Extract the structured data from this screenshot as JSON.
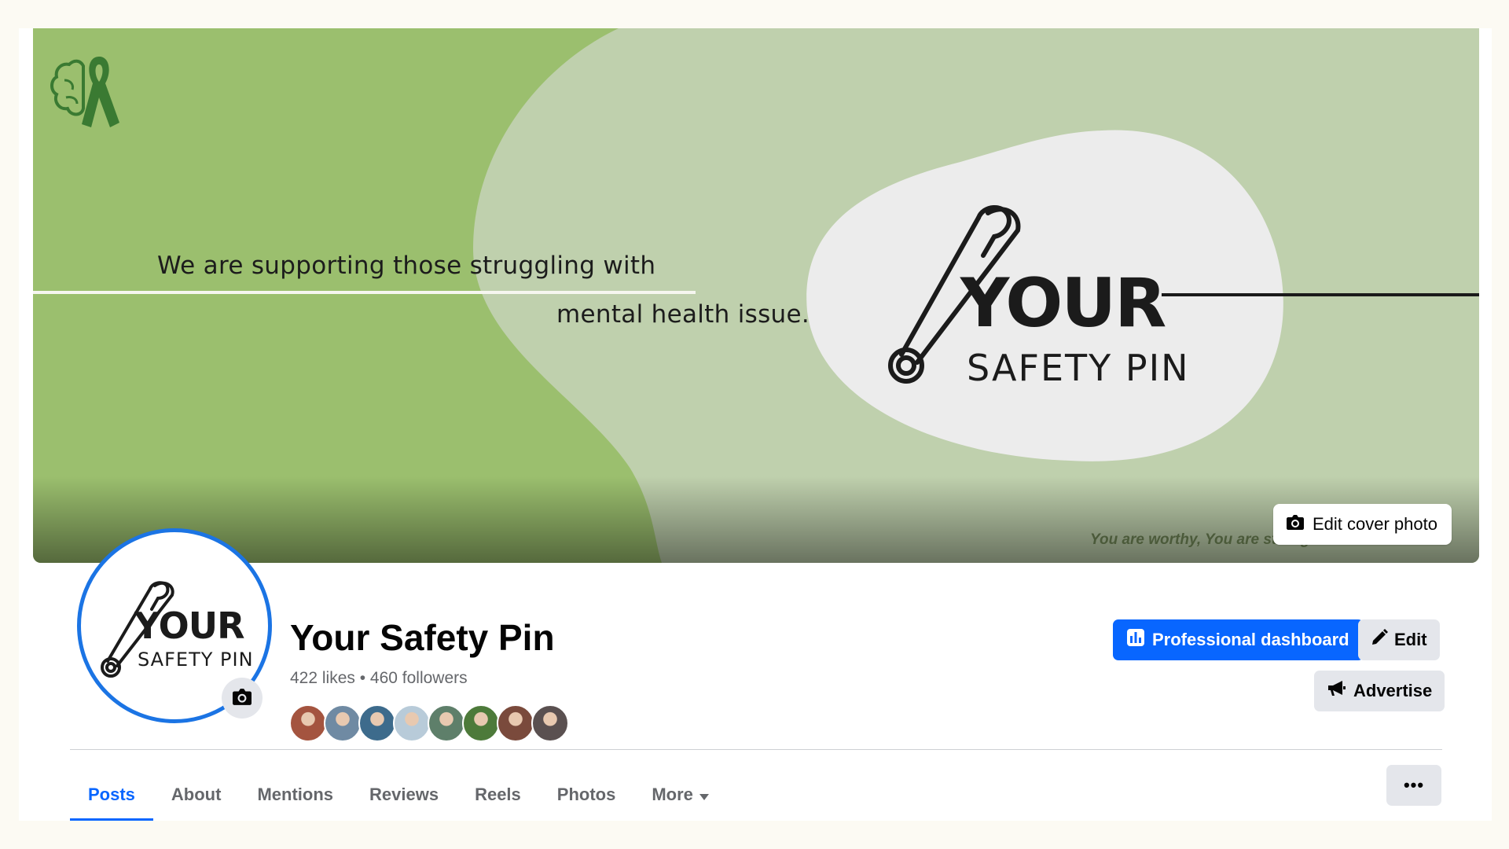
{
  "cover": {
    "line1": "We are supporting those struggling with",
    "line2": "mental health issue.",
    "logo_your": "YOUR",
    "logo_safety": "SAFETY PIN",
    "tagline": "You are worthy, You are strong and You matter.",
    "edit_button_label": "Edit cover photo",
    "colors": {
      "dark_green": "#9bbf6e",
      "light_green": "#bfd0ad",
      "blob": "#ececec",
      "ribbon": "#3a7a32"
    }
  },
  "profile": {
    "avatar_your": "YOUR",
    "avatar_safety": "SAFETY PIN",
    "name": "Your Safety Pin",
    "stats": "422 likes • 460 followers",
    "follower_faces": [
      "#a4543f",
      "#6f8aa3",
      "#3d6b8c",
      "#b8cbd9",
      "#5e7f6a",
      "#4d7a3a",
      "#7a4a3c",
      "#5a5050"
    ]
  },
  "actions": {
    "professional_dashboard": "Professional dashboard",
    "edit": "Edit",
    "advertise": "Advertise"
  },
  "tabs": [
    {
      "label": "Posts",
      "active": true
    },
    {
      "label": "About"
    },
    {
      "label": "Mentions"
    },
    {
      "label": "Reviews"
    },
    {
      "label": "Reels"
    },
    {
      "label": "Photos"
    },
    {
      "label": "More"
    }
  ],
  "more_options_label": "•••",
  "colors": {
    "accent": "#0866ff",
    "avatar_ring": "#1b74e4",
    "secondary_text": "#65676b",
    "button_gray": "#e4e6eb"
  },
  "icons": {
    "cover_corner": "brain-ribbon-icon",
    "camera": "camera-icon",
    "dashboard": "bar-chart-icon",
    "edit": "pencil-icon",
    "advertise": "megaphone-icon",
    "more_caret": "caret-down-icon"
  }
}
